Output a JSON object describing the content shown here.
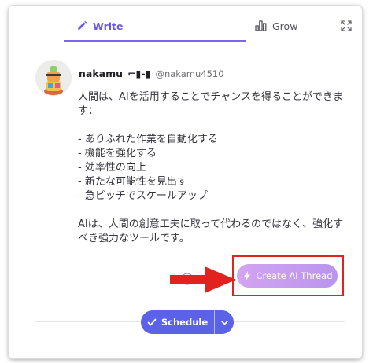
{
  "tabs": {
    "write_label": "Write",
    "grow_label": "Grow",
    "active": "Write"
  },
  "user": {
    "name": "nakamu",
    "name_badge": "⌐▮-▮",
    "handle": "@nakamu4510"
  },
  "post": {
    "text": "人間は、AIを活用することでチャンスを得ることができます：\n\n- ありふれた作業を自動化する\n- 機能を強化する\n- 効率性の向上\n- 新たな可能性を見出す\n- 急ピッチでスケールアップ\n\nAIは、人間の創意工夫に取って代わるのではなく、強化すべき強力なツールです。"
  },
  "actions": {
    "create_thread_label": "Create AI Thread",
    "schedule_label": "Schedule"
  },
  "colors": {
    "accent": "#6a55e8",
    "schedule": "#5b62e8",
    "highlight_box": "#e0231c",
    "arrow": "#e0231c",
    "create_gradient_start": "#d3a4f1",
    "create_gradient_end": "#b995ee"
  },
  "icons": {
    "write_tab": "pencil-icon",
    "grow_tab": "bar-chart-icon",
    "expand": "expand-icon",
    "create_thread": "sparkle-icon",
    "schedule": "check-icon",
    "schedule_dropdown": "chevron-down-icon"
  }
}
